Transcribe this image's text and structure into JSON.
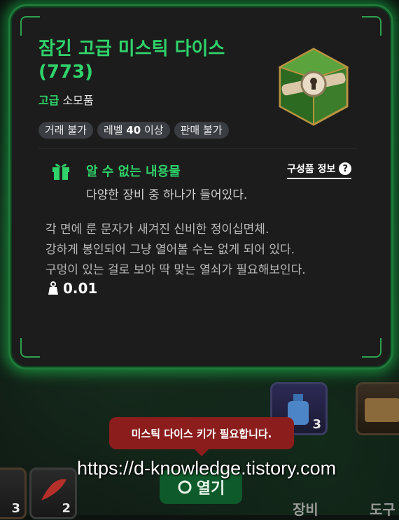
{
  "item": {
    "name": "잠긴 고급 미스틱 다이스(773)",
    "grade": "고급",
    "category": "소모품",
    "tags": [
      {
        "text": "거래 불가"
      },
      {
        "prefix": "레벨 ",
        "strong": "40",
        "suffix": " 이상"
      },
      {
        "text": "판매 불가"
      }
    ]
  },
  "unknown_contents": {
    "title": "알 수 없는 내용물",
    "desc": "다양한 장비 중 하나가 들어있다.",
    "info_link": "구성품 정보",
    "help_glyph": "?"
  },
  "description": [
    "각 면에 룬 문자가 새겨진 신비한 정이십면체.",
    "강하게 봉인되어 그냥 열어볼 수는 없게 되어 있다.",
    "구멍이 있는 걸로 보아 딱 맞는 열쇠가 필요해보인다."
  ],
  "weight": "0.01",
  "toast": "미스틱 다이스 키가 필요합니다.",
  "open_button": "열기",
  "slots": [
    {
      "count": "3"
    },
    {
      "count": "2"
    },
    {
      "count": "3"
    }
  ],
  "bottom_labels": [
    "장비",
    "도구"
  ],
  "watermark": "https://d-knowledge.tistory.com",
  "colors": {
    "accent": "#2fd36a",
    "toast": "#8b1d1d",
    "frame": "#1f7a3a"
  }
}
